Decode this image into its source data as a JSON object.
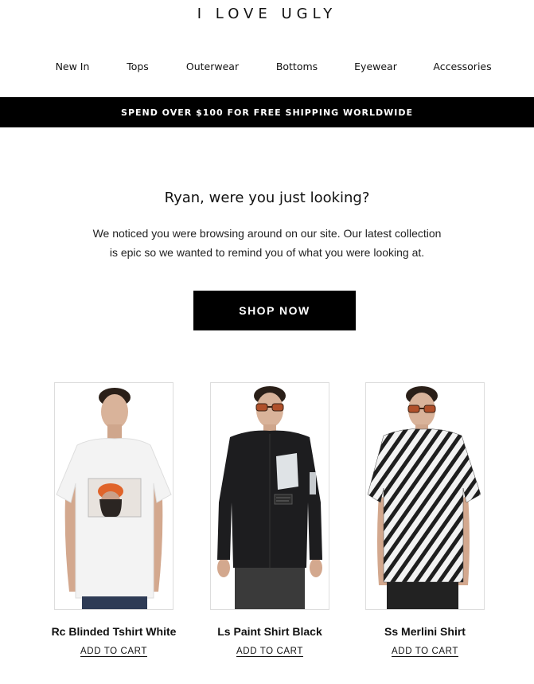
{
  "brand": {
    "logo_text": "I LOVE UGLY"
  },
  "nav": {
    "items": [
      "New In",
      "Tops",
      "Outerwear",
      "Bottoms",
      "Eyewear",
      "Accessories"
    ]
  },
  "banner": {
    "text": "SPEND OVER $100 FOR FREE SHIPPING WORLDWIDE"
  },
  "hero": {
    "headline": "Ryan, were you just looking?",
    "line1": "We noticed you were browsing around on our site. Our latest collection",
    "line2": "is epic so we wanted to remind you of what you were looking at.",
    "cta_label": "SHOP NOW"
  },
  "products": [
    {
      "name": "Rc Blinded Tshirt White",
      "cart_label": "ADD TO CART"
    },
    {
      "name": "Ls Paint Shirt Black",
      "cart_label": "ADD TO CART"
    },
    {
      "name": "Ss Merlini Shirt",
      "cart_label": "ADD TO CART"
    }
  ],
  "colors": {
    "banner_bg": "#000000",
    "button_bg": "#000000",
    "text": "#111111"
  }
}
